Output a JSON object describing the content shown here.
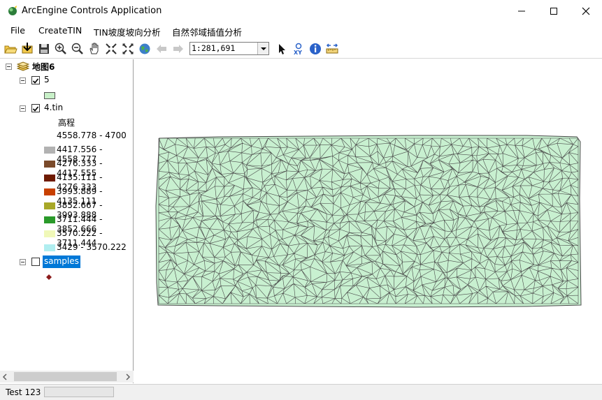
{
  "window": {
    "title": "ArcEngine Controls Application"
  },
  "menu": {
    "items": [
      "File",
      "CreateTIN",
      "TIN坡度坡向分析",
      "自然邻域插值分析"
    ]
  },
  "toolbar": {
    "scale_value": "1:281,691",
    "icons": [
      "open-folder-icon",
      "add-data-icon",
      "save-icon",
      "zoom-in-icon",
      "zoom-out-icon",
      "pan-hand-icon",
      "fixed-zoom-in-icon",
      "fixed-zoom-out-icon",
      "full-extent-globe-icon",
      "back-arrow-icon",
      "forward-arrow-icon",
      "select-arrow-icon",
      "go-to-xy-icon",
      "identify-icon",
      "measure-icon"
    ]
  },
  "toc": {
    "map_name": "地图6",
    "layers": [
      {
        "name": "5",
        "checked": true,
        "swatch": "#c8f0c8"
      },
      {
        "name": "4.tin",
        "checked": true,
        "field": "高程",
        "classes": [
          {
            "label": "4558.778 - 4700",
            "color": "#ffffff"
          },
          {
            "label": "4417.556 - 4558.777",
            "color": "#b2b2b2"
          },
          {
            "label": "4276.333 - 4417.555",
            "color": "#7a4a2a"
          },
          {
            "label": "4135.111 - 4276.333",
            "color": "#6e1a00"
          },
          {
            "label": "3993.889 - 4135.111",
            "color": "#c84000"
          },
          {
            "label": "3852.667 - 3993.888",
            "color": "#a8a828"
          },
          {
            "label": "3711.444 - 3852.666",
            "color": "#2a9a2a"
          },
          {
            "label": "3570.222 - 3711.444",
            "color": "#f0f8b8"
          },
          {
            "label": "3429 - 3570.222",
            "color": "#b0eef0"
          }
        ]
      },
      {
        "name": "samples",
        "checked": false,
        "selected": true,
        "marker_color": "#8b1a1a"
      }
    ]
  },
  "map": {
    "fill_color": "#c8f0d0",
    "edge_color": "#4a4a4a"
  },
  "status": {
    "text": "Test 123"
  },
  "colors": {
    "selection": "#0078d7"
  }
}
